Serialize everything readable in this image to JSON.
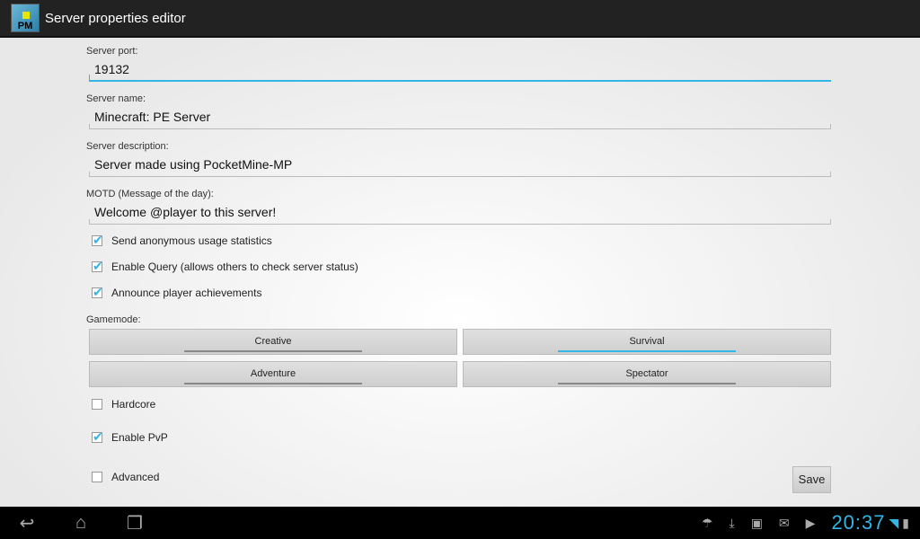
{
  "app": {
    "title": "Server properties editor",
    "icon_text": "PM"
  },
  "fields": [
    {
      "label": "Server port:",
      "value": "19132"
    },
    {
      "label": "Server name:",
      "value": "Minecraft: PE Server"
    },
    {
      "label": "Server description:",
      "value": "Server made using PocketMine-MP"
    },
    {
      "label": "MOTD (Message of the day):",
      "value": "Welcome @player to this server!"
    }
  ],
  "checks": [
    {
      "label": "Send anonymous usage statistics",
      "checked": true
    },
    {
      "label": "Enable Query (allows others to check server status)",
      "checked": true
    },
    {
      "label": "Announce player achievements",
      "checked": true
    }
  ],
  "gamemode": {
    "label": "Gamemode:",
    "options": [
      "Creative",
      "Survival",
      "Adventure",
      "Spectator"
    ],
    "selected": "Survival"
  },
  "hardcore": {
    "label": "Hardcore",
    "checked": false
  },
  "pvp": {
    "label": "Enable PvP",
    "checked": true
  },
  "advanced": {
    "label": "Advanced",
    "checked": false
  },
  "save_label": "Save",
  "status": {
    "time": "20:37"
  }
}
